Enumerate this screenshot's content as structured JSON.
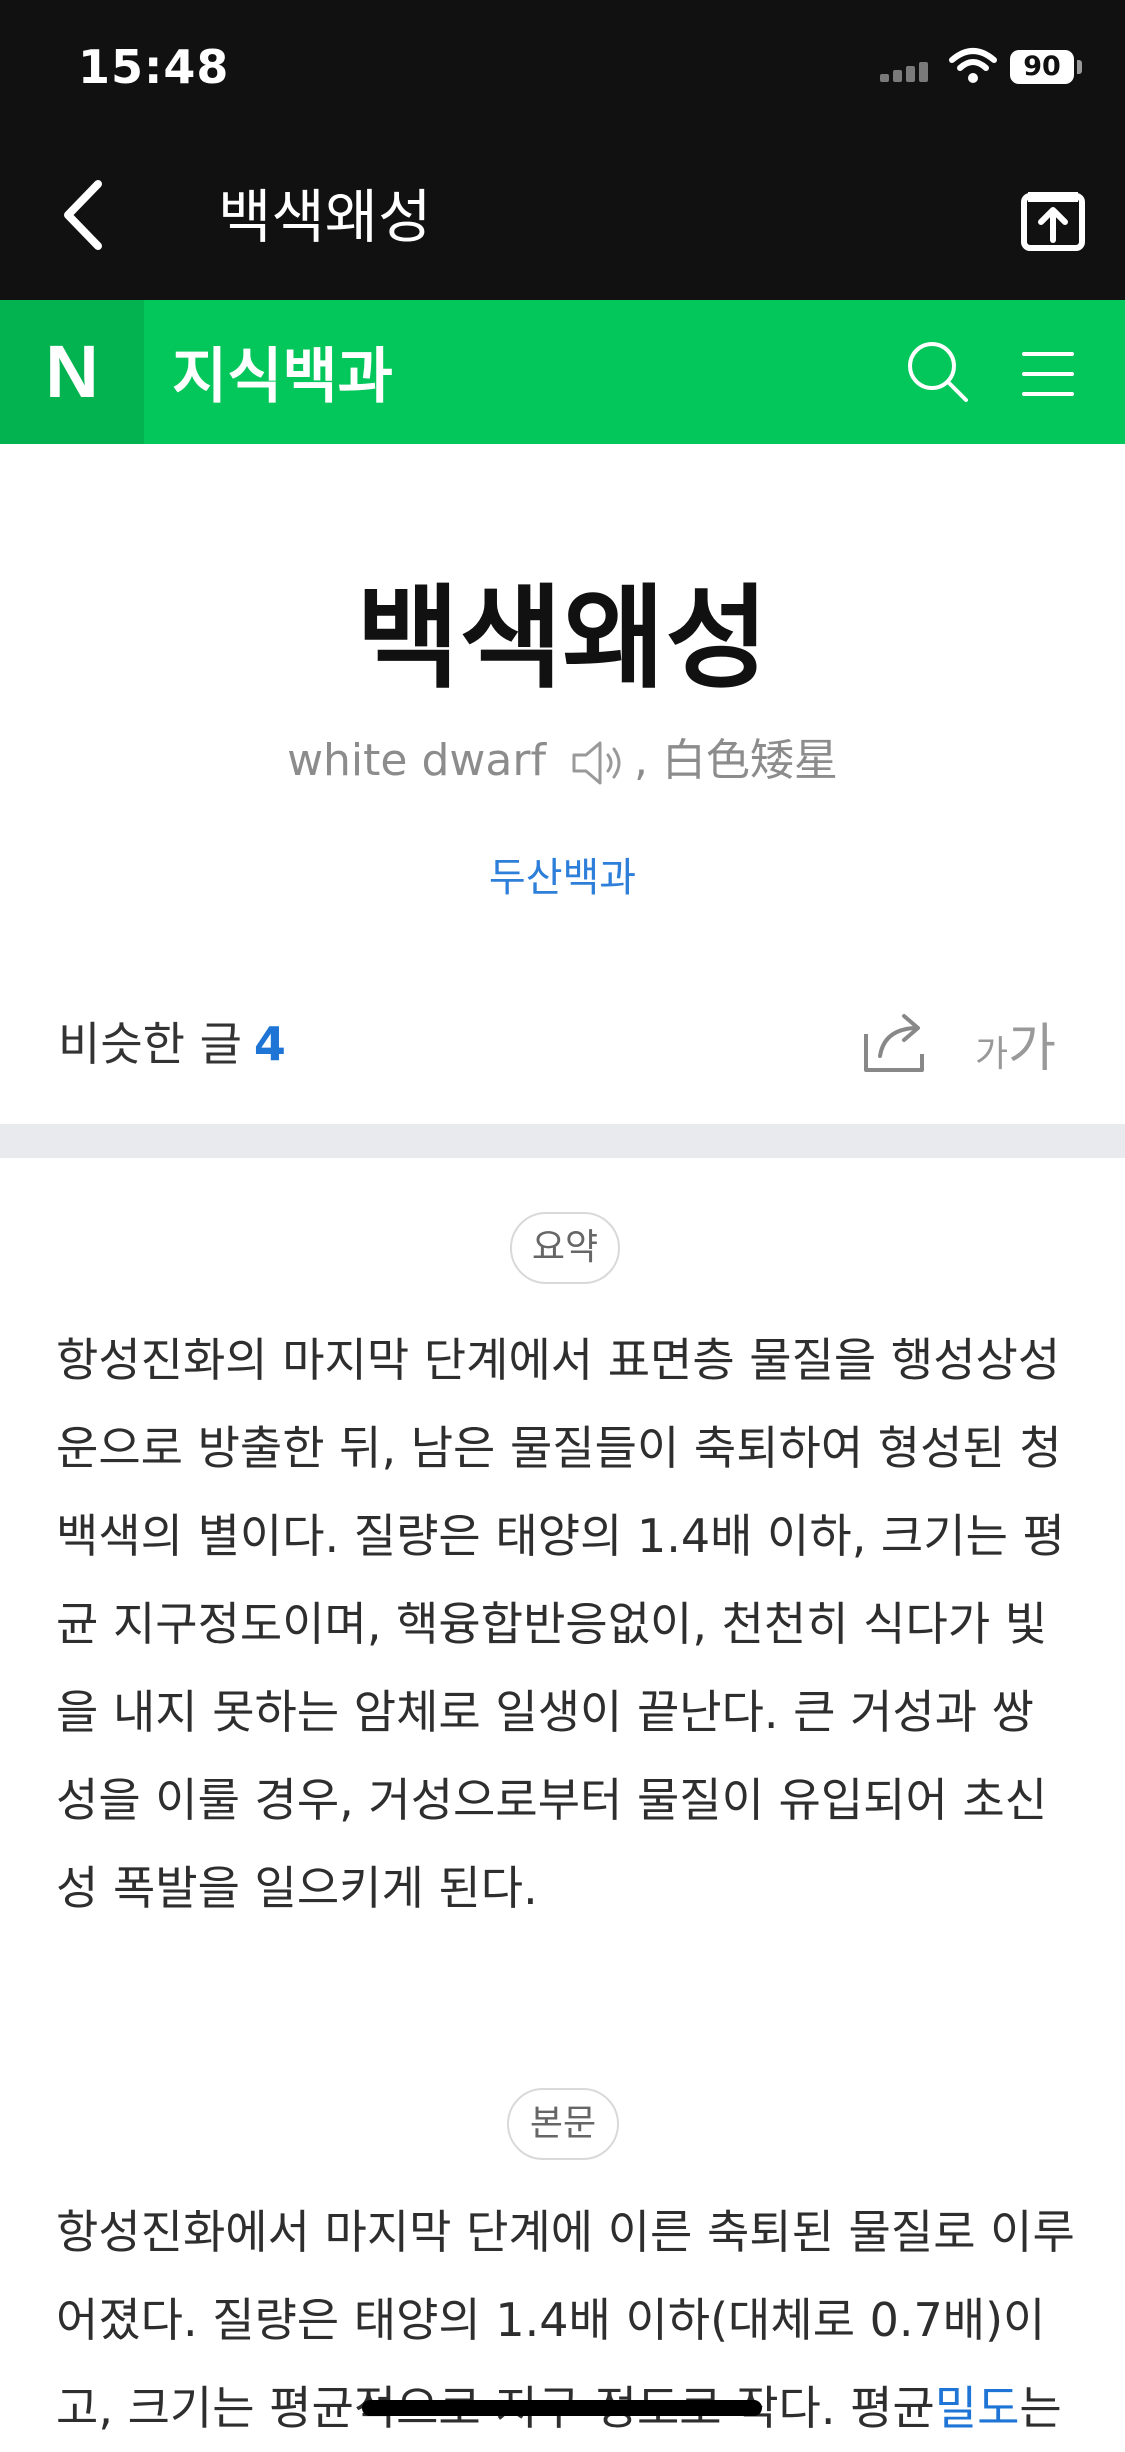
{
  "status_bar": {
    "time": "15:48",
    "battery": "90"
  },
  "app_bar": {
    "title": "백색왜성"
  },
  "brand": {
    "logo": "N",
    "title": "지식백과"
  },
  "icons": {
    "back": "chevron-left-icon",
    "share": "share-box-icon",
    "search": "search-icon",
    "menu": "hamburger-menu-icon",
    "speaker": "speaker-icon",
    "share2": "share-arrow-icon"
  },
  "colors": {
    "green": "#03c75a",
    "link": "#1f75d6"
  },
  "article": {
    "title": "백색왜성",
    "english": "white dwarf",
    "separator": ",",
    "hanja": "白色矮星",
    "source": "두산백과",
    "similar_label": "비슷한 글",
    "similar_count": "4",
    "font_small": "가",
    "font_large": "가"
  },
  "summary": {
    "tag": "요약",
    "text": "항성진화의 마지막 단계에서 표면층 물질을 행성상성운으로 방출한 뒤, 남은 물질들이 축퇴하여 형성된 청백색의 별이다. 질량은 태양의 1.4배 이하, 크기는 평균 지구정도이며, 핵융합반응없이, 천천히 식다가 빛을 내지 못하는 암체로 일생이 끝난다. 큰 거성과 쌍성을 이룰 경우, 거성으로부터 물질이 유입되어 초신성 폭발을 일으키게 된다."
  },
  "body": {
    "tag": "본문",
    "text_before_link": "항성진화에서 마지막 단계에 이른 축퇴된 물질로 이루어졌다. 질량은 태양의 1.4배 이하(대체로 0.7배)이고, 크기는 평균적으로 지구 정도로 작다. 평균",
    "link": "밀도",
    "text_after_link": "는"
  }
}
